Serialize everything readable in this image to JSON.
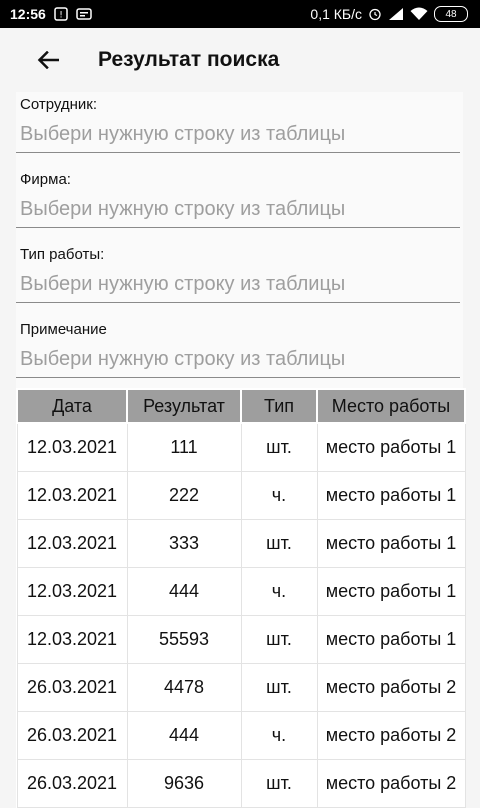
{
  "status_bar": {
    "time": "12:56",
    "speed": "0,1 КБ/с",
    "battery": "48"
  },
  "header": {
    "title": "Результат поиска"
  },
  "form": {
    "fields": [
      {
        "label": "Сотрудник:",
        "placeholder": "Выбери нужную строку из таблицы"
      },
      {
        "label": "Фирма:",
        "placeholder": "Выбери нужную строку из таблицы"
      },
      {
        "label": "Тип работы:",
        "placeholder": "Выбери нужную строку из таблицы"
      },
      {
        "label": "Примечание",
        "placeholder": "Выбери нужную строку из таблицы"
      }
    ]
  },
  "table": {
    "columns": [
      "Дата",
      "Результат",
      "Тип",
      "Место работы"
    ],
    "rows": [
      [
        "12.03.2021",
        "111",
        "шт.",
        "место работы 1"
      ],
      [
        "12.03.2021",
        "222",
        "ч.",
        "место работы 1"
      ],
      [
        "12.03.2021",
        "333",
        "шт.",
        "место работы 1"
      ],
      [
        "12.03.2021",
        "444",
        "ч.",
        "место работы 1"
      ],
      [
        "12.03.2021",
        "55593",
        "шт.",
        "место работы 1"
      ],
      [
        "26.03.2021",
        "4478",
        "шт.",
        "место работы 2"
      ],
      [
        "26.03.2021",
        "444",
        "ч.",
        "место работы 2"
      ],
      [
        "26.03.2021",
        "9636",
        "шт.",
        "место работы 2"
      ]
    ]
  }
}
